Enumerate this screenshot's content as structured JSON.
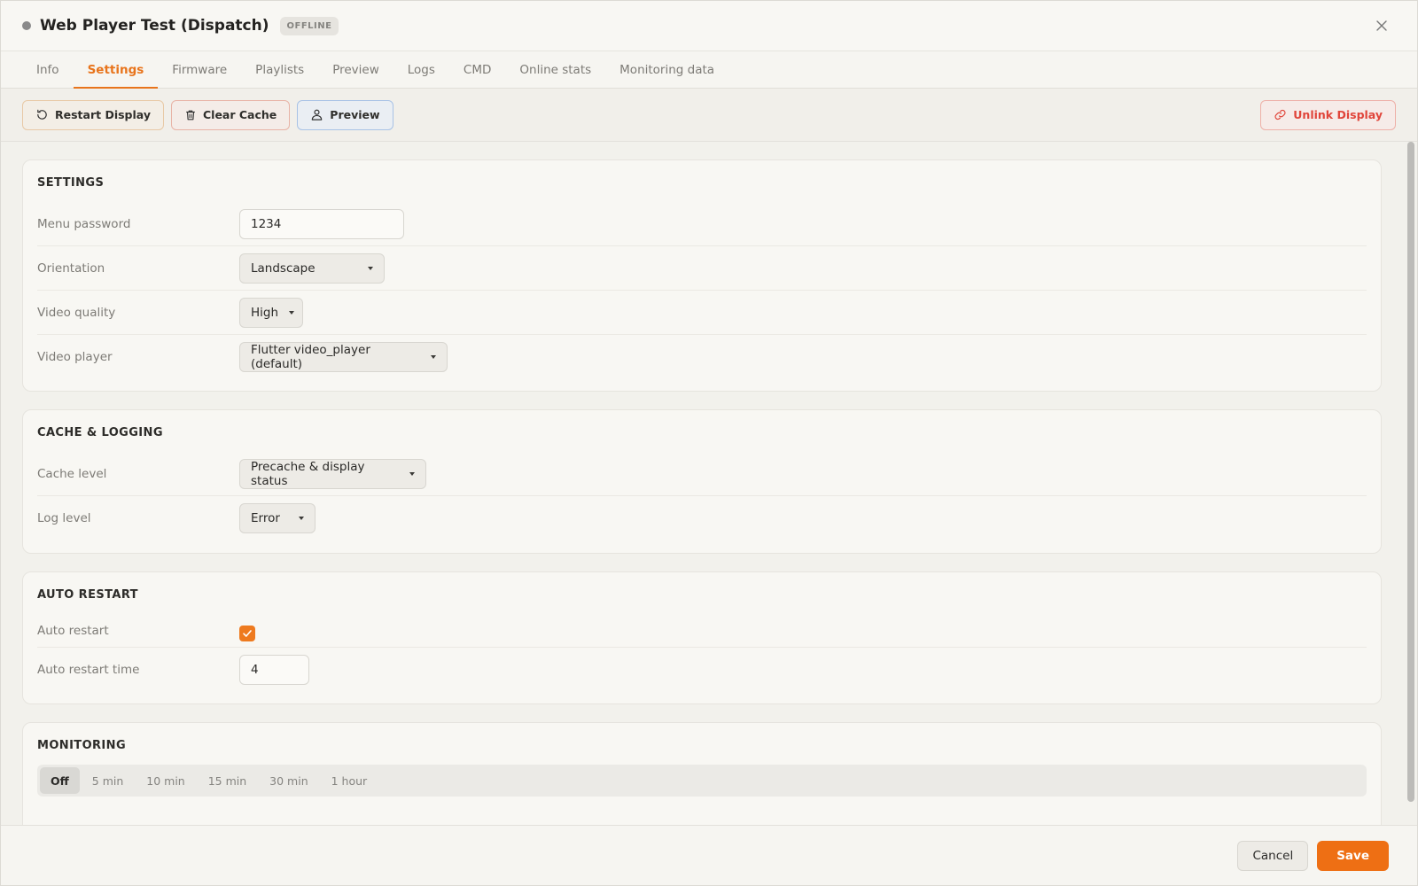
{
  "header": {
    "title": "Web Player Test (Dispatch)",
    "status": "OFFLINE",
    "close_icon": "close-icon"
  },
  "tabs": [
    {
      "label": "Info",
      "active": false
    },
    {
      "label": "Settings",
      "active": true
    },
    {
      "label": "Firmware",
      "active": false
    },
    {
      "label": "Playlists",
      "active": false
    },
    {
      "label": "Preview",
      "active": false
    },
    {
      "label": "Logs",
      "active": false
    },
    {
      "label": "CMD",
      "active": false
    },
    {
      "label": "Online stats",
      "active": false
    },
    {
      "label": "Monitoring data",
      "active": false
    }
  ],
  "toolbar": {
    "restart_label": "Restart Display",
    "clear_cache_label": "Clear Cache",
    "preview_label": "Preview",
    "unlink_label": "Unlink Display"
  },
  "settings": {
    "title": "SETTINGS",
    "menu_password": {
      "label": "Menu password",
      "value": "1234"
    },
    "orientation": {
      "label": "Orientation",
      "value": "Landscape"
    },
    "video_quality": {
      "label": "Video quality",
      "value": "High"
    },
    "video_player": {
      "label": "Video player",
      "value": "Flutter video_player (default)"
    }
  },
  "cache_logging": {
    "title": "CACHE & LOGGING",
    "cache_level": {
      "label": "Cache level",
      "value": "Precache & display status"
    },
    "log_level": {
      "label": "Log level",
      "value": "Error"
    }
  },
  "auto_restart": {
    "title": "AUTO RESTART",
    "enabled": {
      "label": "Auto restart",
      "checked": true
    },
    "time": {
      "label": "Auto restart time",
      "value": "4"
    }
  },
  "monitoring": {
    "title": "MONITORING",
    "options": [
      "Off",
      "5 min",
      "10 min",
      "15 min",
      "30 min",
      "1 hour"
    ],
    "selected": "Off"
  },
  "footer": {
    "cancel_label": "Cancel",
    "save_label": "Save"
  },
  "colors": {
    "accent": "#ee6f14",
    "danger": "#e0453a",
    "status_offline": "#8a8a8a"
  }
}
